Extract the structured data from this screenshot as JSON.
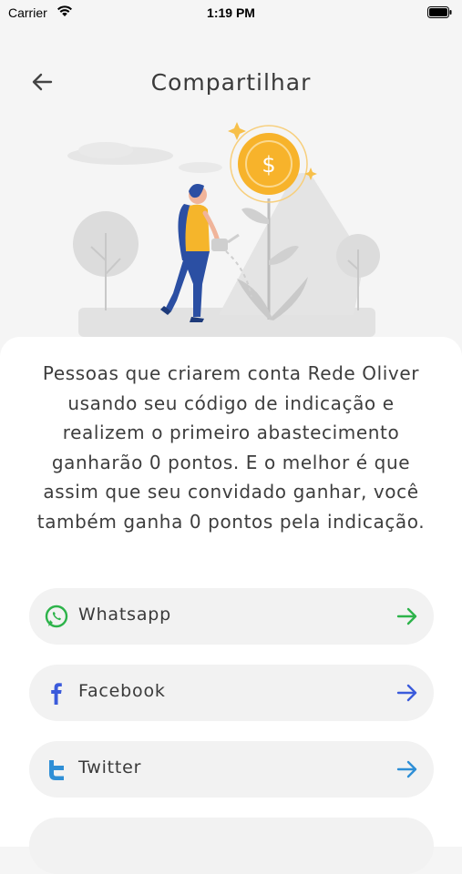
{
  "status_bar": {
    "carrier": "Carrier",
    "time": "1:19 PM"
  },
  "header": {
    "title": "Compartilhar"
  },
  "description": "Pessoas que criarem conta Rede Oliver usando seu código de indicação e realizem o primeiro abastecimento ganharão 0 pontos. E o melhor é que assim que seu convidado ganhar, você também ganha 0 pontos pela indicação.",
  "share_options": [
    {
      "label": "Whatsapp",
      "icon": "whatsapp-icon",
      "accent": "#2db34a"
    },
    {
      "label": "Facebook",
      "icon": "facebook-icon",
      "accent": "#3b5bdb"
    },
    {
      "label": "Twitter",
      "icon": "twitter-icon",
      "accent": "#2f8fd6"
    }
  ],
  "colors": {
    "coin": "#f7b32b",
    "figure_blue": "#2b4fa3",
    "figure_yellow": "#f5b52b"
  }
}
